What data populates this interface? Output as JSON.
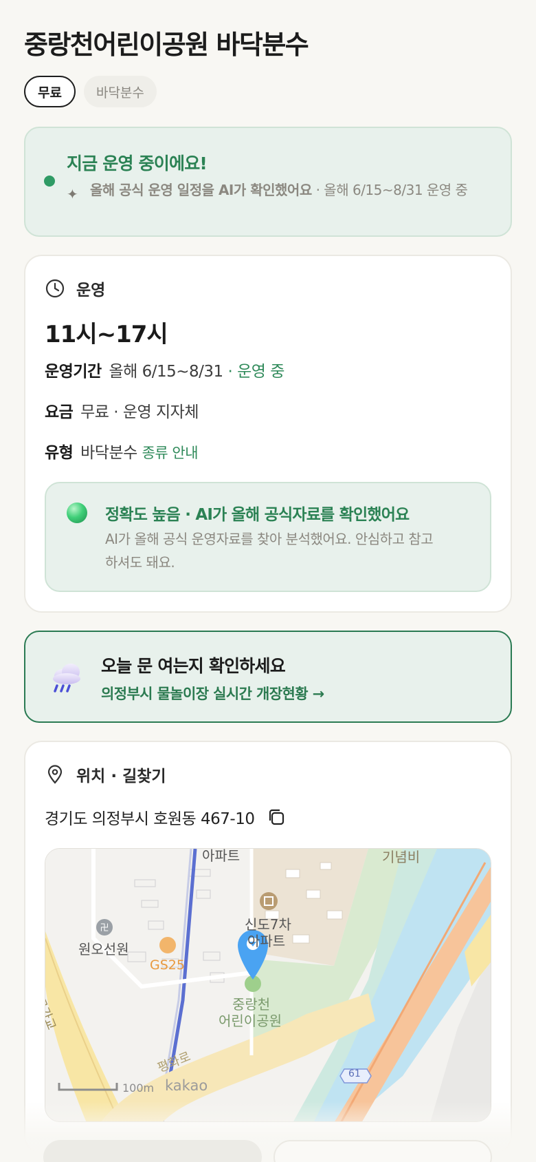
{
  "page": {
    "title": "중랑천어린이공원 바닥분수",
    "tags": [
      "무료",
      "바닥분수"
    ]
  },
  "status": {
    "title": "지금 운영 중이에요!",
    "desc_bold": "올해 공식 운영 일정을 AI가 확인했어요",
    "desc_rest": " · 올해 6/15~8/31 운영 중"
  },
  "ops": {
    "label": "운영",
    "hours": "11시~17시",
    "period_label": "운영기간",
    "period_value": "올해 6/15~8/31",
    "period_status": "· 운영 중",
    "fee_label": "요금",
    "fee_value": "무료 · 운영 지자체",
    "type_label": "유형",
    "type_value": "바닥분수",
    "type_link": "종류 안내",
    "accuracy_title": "정확도 높음 · AI가 올해 공식자료를 확인했어요",
    "accuracy_desc": "AI가 올해 공식 운영자료를 찾아 분석했어요. 안심하고 참고하셔도 돼요."
  },
  "promo": {
    "title": "오늘 문 여는지 확인하세요",
    "link": "의정부시 물놀이장 실시간 개장현황 →"
  },
  "location": {
    "label": "위치 · 길찾기",
    "address": "경기도 의정부시 호원동 467-10",
    "map": {
      "labels": {
        "apt_top": "아파트",
        "memorial": "기념비",
        "temple": "원오선원",
        "gs25": "GS25",
        "apt_name1": "신도7차",
        "apt_name2": "아파트",
        "park1": "중랑천",
        "park2": "어린이공원",
        "road_left": "호원고가교",
        "road_bottom": "평화로",
        "route": "61",
        "scale": "100m",
        "logo": "kakao"
      }
    }
  },
  "colors": {
    "accent_green": "#2b8254",
    "status_bg": "#e8f1ec",
    "page_bg": "#f8f7f3"
  }
}
